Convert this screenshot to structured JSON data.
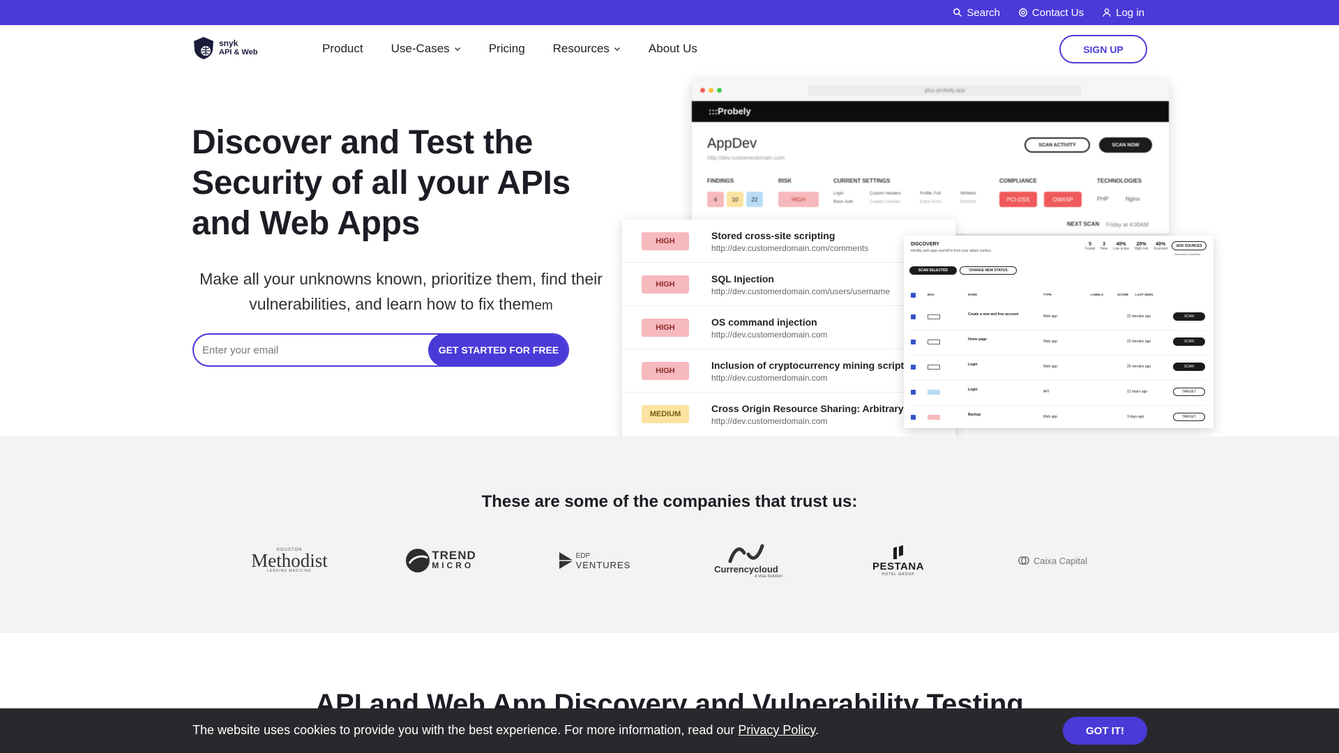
{
  "topbar": {
    "search": "Search",
    "contact": "Contact Us",
    "login": "Log in"
  },
  "logo": {
    "line1": "snyk",
    "line2": "API & Web"
  },
  "nav": {
    "items": [
      {
        "label": "Product",
        "dropdown": false
      },
      {
        "label": "Use-Cases",
        "dropdown": true
      },
      {
        "label": "Pricing",
        "dropdown": false
      },
      {
        "label": "Resources",
        "dropdown": true
      },
      {
        "label": "About Us",
        "dropdown": false
      }
    ],
    "signup": "SIGN UP"
  },
  "hero": {
    "title": "Discover and Test the Security of all your APIs and Web Apps",
    "subtitle": "Make all your unknowns known, prioritize them, find their vulnerabilities, and learn how to fix them",
    "subtitle_tail": "em",
    "email_placeholder": "Enter your email",
    "cta": "GET STARTED FOR FREE"
  },
  "mock_main": {
    "url": "plus.probely.app",
    "brand": ":::Probely",
    "app_title": "AppDev",
    "app_url": "http://dev.customerdomain.com",
    "scan_activity": "SCAN ACTIVITY",
    "scan_now": "SCAN NOW",
    "findings_label": "FINDINGS",
    "findings": [
      "4",
      "10",
      "22"
    ],
    "risk_label": "RISK",
    "risk": "HIGH",
    "settings_label": "CURRENT SETTINGS",
    "settings": [
      "Login",
      "Custom Headers",
      "Profile: Full",
      "Whitelist",
      "Basic Auth",
      "Crawler Cookies",
      "Extra Hosts",
      "Blacklist"
    ],
    "compliance_label": "COMPLIANCE",
    "compliance": [
      "PCI-DSS",
      "OWASP"
    ],
    "tech_label": "TECHNOLOGIES",
    "tech": [
      "PHP",
      "Nginx"
    ],
    "next_scan_label": "NEXT SCAN",
    "next_scan": "Friday at 4:00AM"
  },
  "vulns": [
    {
      "severity": "HIGH",
      "title": "Stored cross-site scripting",
      "url": "http://dev.customerdomain.com/comments"
    },
    {
      "severity": "HIGH",
      "title": "SQL Injection",
      "url": "http://dev.customerdomain.com/users/username"
    },
    {
      "severity": "HIGH",
      "title": "OS command injection",
      "url": "http://dev.customerdomain.com"
    },
    {
      "severity": "HIGH",
      "title": "Inclusion of cryptocurrency mining script",
      "url": "http://dev.customerdomain.com"
    },
    {
      "severity": "MEDIUM",
      "title": "Cross Origin Resource Sharing: Arbitrary origin",
      "url": "http://dev.customerdomain.com"
    }
  ],
  "discovery": {
    "title": "DISCOVERY",
    "subtitle": "Identify web apps and APIs from your attack surface",
    "stats": [
      {
        "value": "5",
        "label": "Found"
      },
      {
        "value": "3",
        "label": "New"
      },
      {
        "value": "40%",
        "label": "Low score"
      },
      {
        "value": "20%",
        "label": "High risk"
      },
      {
        "value": "40%",
        "label": "Scanned"
      }
    ],
    "add_sources": "ADD SOURCES",
    "completed": "Discovery completed",
    "scan_selected": "SCAN SELECTED",
    "change_status": "CHANGE NEW STATUS",
    "columns": [
      "BOX",
      "NAME",
      "TYPE",
      "LABELS",
      "SCORE",
      "LAST SEEN"
    ],
    "rows": [
      {
        "name": "Create a new and free account",
        "type": "Web app",
        "seen": "22 minutes ago",
        "action": "SCAN"
      },
      {
        "name": "Home page",
        "type": "Web app",
        "seen": "22 minutes ago",
        "action": "SCAN"
      },
      {
        "name": "Login",
        "type": "Web app",
        "seen": "25 minutes ago",
        "action": "SCAN"
      },
      {
        "name": "Login",
        "type": "API",
        "seen": "12 hours ago",
        "action": "TARGET"
      },
      {
        "name": "Backup",
        "type": "Web app",
        "seen": "3 days ago",
        "action": "TARGET"
      }
    ]
  },
  "trust": {
    "title": "These are some of the companies that trust us:",
    "logos": [
      "Houston Methodist",
      "Trend Micro",
      "EDP Ventures",
      "Currencycloud",
      "Pestana",
      "Caixa Capital"
    ],
    "methodist_top": "HOUSTON",
    "methodist_main": "Methodist",
    "methodist_bottom": "LEADING MEDICINE",
    "trend_main": "TREND",
    "trend_sub": "MICRO",
    "edp_top": "EDP",
    "edp_main": "VENTURES",
    "cc_main": "Currencycloud",
    "cc_sub": "A Visa Solution",
    "pestana_main": "PESTANA",
    "pestana_sub": "HOTEL GROUP",
    "caixa": "Caixa Capital"
  },
  "section": {
    "title": "API and Web App Discovery and Vulnerability Testing"
  },
  "cookie": {
    "text": "The website uses cookies to provide you with the best experience. For more information, read our ",
    "link": "Privacy Policy",
    "end": ".",
    "button": "GOT IT!"
  },
  "colors": {
    "brand": "#4a3ad8",
    "dark": "#29292d",
    "band": "#f3f3f3",
    "high": "#f6b9bd",
    "medium": "#fbe3a1"
  }
}
